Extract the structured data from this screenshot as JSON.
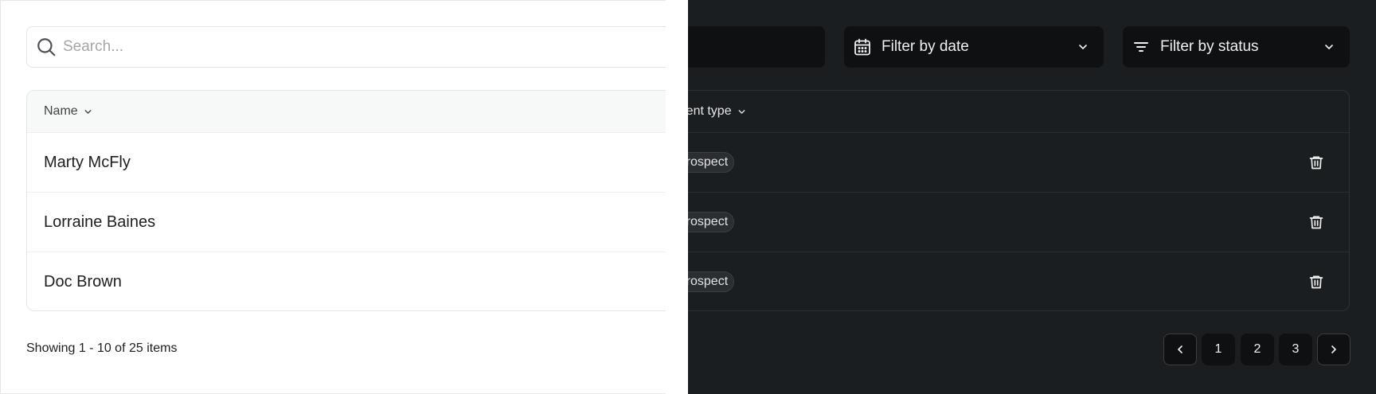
{
  "search": {
    "placeholder": "Search..."
  },
  "filters": {
    "date_label": "Filter by date",
    "status_label": "Filter by status"
  },
  "table": {
    "columns": {
      "name": "Name",
      "client_type": "Client type"
    },
    "rows": [
      {
        "name": "Marty McFly",
        "client_type": "Prospect"
      },
      {
        "name": "Lorraine Baines",
        "client_type": "Prospect"
      },
      {
        "name": "Doc Brown",
        "client_type": "Prospect"
      }
    ]
  },
  "footer": {
    "showing": "Showing 1 - 10 of 25 items"
  },
  "pagination": {
    "pages": [
      "1",
      "2",
      "3"
    ]
  },
  "icons": {
    "search": "search-icon",
    "calendar": "calendar-icon",
    "filter": "filter-lines-icon",
    "chevron_down": "chevron-down-icon",
    "trash": "trash-icon",
    "chevron_left": "chevron-left-icon",
    "chevron_right": "chevron-right-icon"
  },
  "colors": {
    "light_bg": "#ffffff",
    "dark_bg": "#1b1e20",
    "dark_control": "#0e1011"
  }
}
